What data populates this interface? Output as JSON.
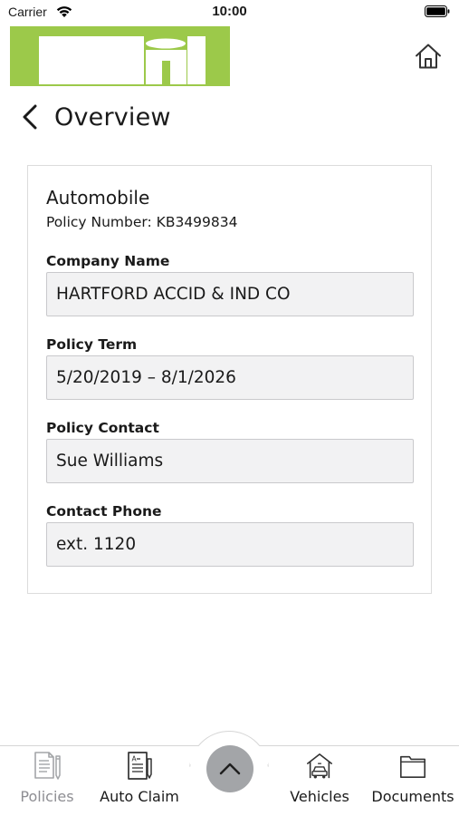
{
  "status_bar": {
    "carrier": "Carrier",
    "time": "10:00"
  },
  "header": {
    "logo_color": "#9cc94a",
    "home_icon": "home-icon"
  },
  "nav": {
    "back_icon": "chevron-left-icon",
    "title": "Overview"
  },
  "policy": {
    "type": "Automobile",
    "number_text": "Policy Number: KB3499834",
    "fields": [
      {
        "label": "Company Name",
        "value": "HARTFORD ACCID & IND CO"
      },
      {
        "label": "Policy Term",
        "value": "5/20/2019 – 8/1/2026"
      },
      {
        "label": "Policy Contact",
        "value": "Sue Williams"
      },
      {
        "label": "Contact Phone",
        "value": "ext. 1120"
      }
    ]
  },
  "tabbar": {
    "tabs": [
      {
        "label": "Policies",
        "icon": "policy-document-icon",
        "active": true
      },
      {
        "label": "Auto Claim",
        "icon": "claim-form-icon",
        "active": false
      },
      {
        "label": "Vehicles",
        "icon": "car-garage-icon",
        "active": false
      },
      {
        "label": "Documents",
        "icon": "folder-icon",
        "active": false
      }
    ],
    "center_button_icon": "chevron-up-icon",
    "center_button_color": "#a3a5a8",
    "inactive_color": "#8e8e93"
  }
}
